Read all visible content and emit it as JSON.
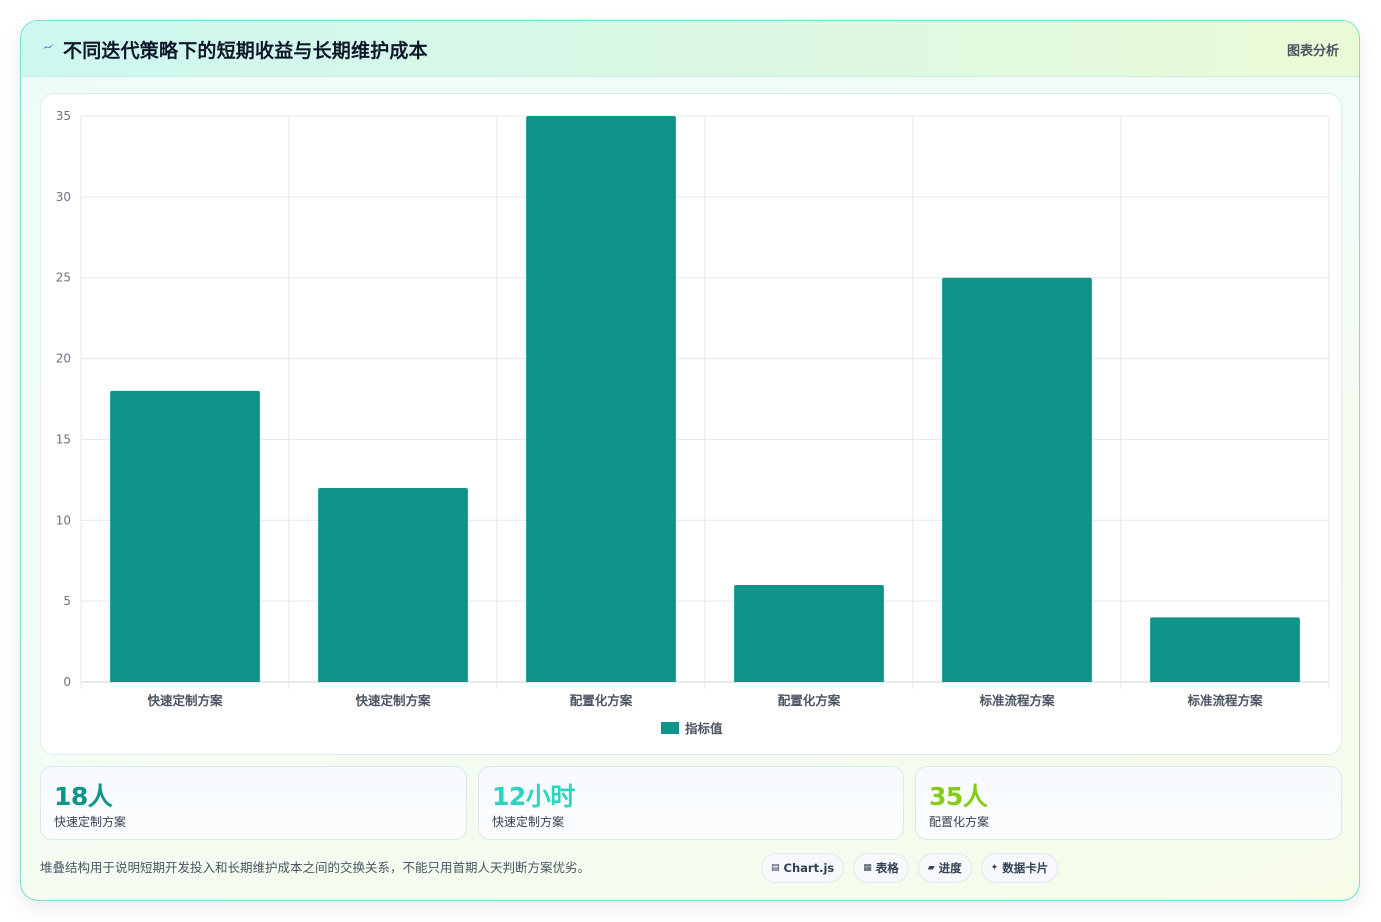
{
  "header": {
    "icon": "lightning-icon",
    "title": "不同迭代策略下的短期收益与长期维护成本",
    "link": "图表分析"
  },
  "colors": {
    "bar": "#0e9488",
    "accent_teal": "#0e9488",
    "accent_cyan": "#2dd4bf",
    "accent_lime": "#84cc16"
  },
  "chart_data": {
    "type": "bar",
    "categories": [
      "快速定制方案",
      "快速定制方案",
      "配置化方案",
      "配置化方案",
      "标准流程方案",
      "标准流程方案"
    ],
    "series": [
      {
        "name": "指标值",
        "values": [
          18,
          12,
          35,
          6,
          25,
          4
        ]
      }
    ],
    "ylim": [
      0,
      35
    ],
    "yticks": [
      0,
      5,
      10,
      15,
      20,
      25,
      30,
      35
    ],
    "grid": true,
    "legend": "bottom"
  },
  "stats": [
    {
      "value": "18人",
      "label": "快速定制方案",
      "color": "#0e9488"
    },
    {
      "value": "12小时",
      "label": "快速定制方案",
      "color": "#2dd4bf"
    },
    {
      "value": "35人",
      "label": "配置化方案",
      "color": "#84cc16"
    }
  ],
  "footnote": "堆叠结构用于说明短期开发投入和长期维护成本之间的交换关系，不能只用首期人天判断方案优劣。",
  "tags": [
    {
      "icon": "bar-chart-icon",
      "glyph": "▤",
      "label": "Chart.js"
    },
    {
      "icon": "table-icon",
      "glyph": "▦",
      "label": "表格"
    },
    {
      "icon": "progress-icon",
      "glyph": "▰",
      "label": "进度"
    },
    {
      "icon": "sparkle-icon",
      "glyph": "✦",
      "label": "数据卡片"
    }
  ]
}
